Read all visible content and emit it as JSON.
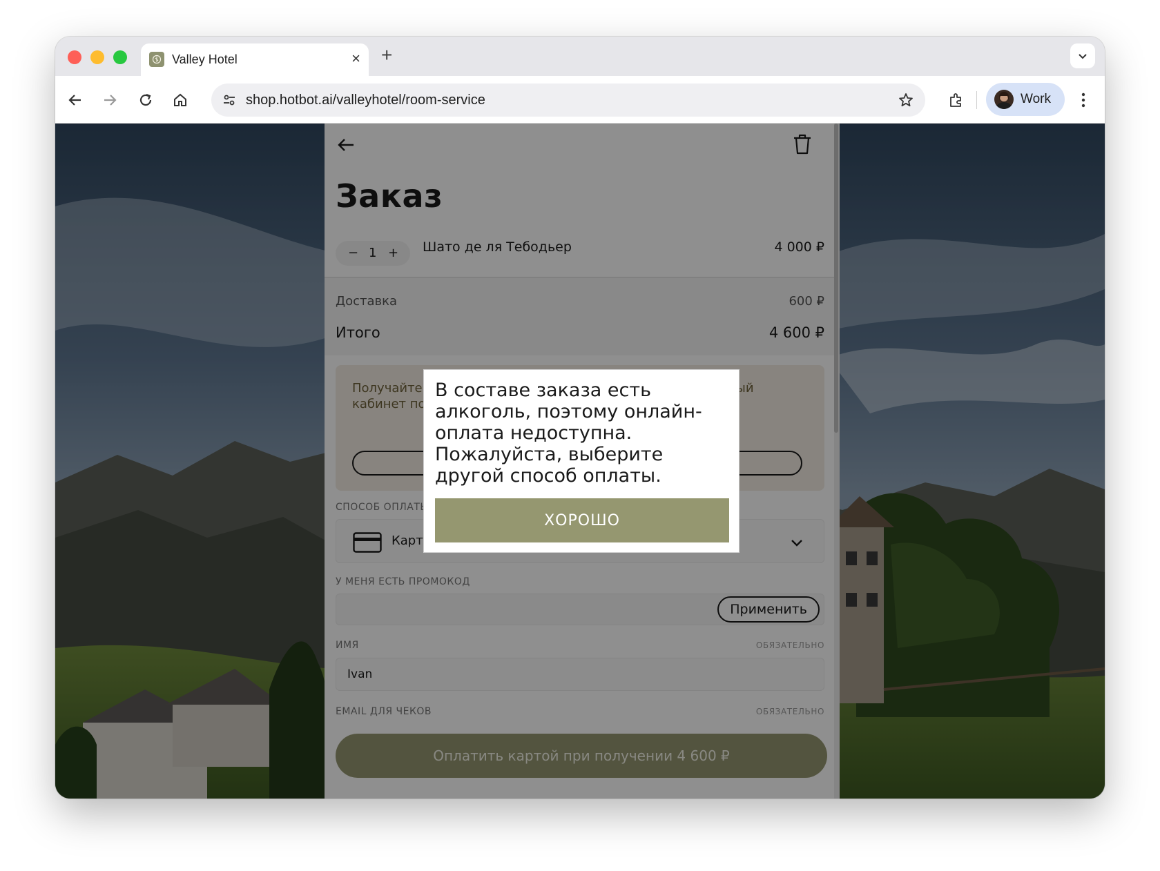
{
  "browser": {
    "tab_title": "Valley Hotel",
    "url": "shop.hotbot.ai/valleyhotel/room-service",
    "profile_name": "Work"
  },
  "order": {
    "title": "Заказ",
    "items": [
      {
        "quantity": "1",
        "name": "Шато де ля Тебодьер",
        "price": "4 000 ₽"
      }
    ],
    "delivery_label": "Доставка",
    "delivery_price": "600 ₽",
    "total_label": "Итого",
    "total_price": "4 600 ₽",
    "loyalty_text": "Получайте бонусы и скидки в Valley Hotel. Войдите в личный кабинет пользователя, чтобы отслеживать",
    "loyalty_brand": "Valley Hotel",
    "payment_method_label": "Способ оплаты",
    "payment_method_value": "Картой при получении",
    "promo_label": "У меня есть промокод",
    "promo_apply": "Применить",
    "name_label": "Имя",
    "name_required": "Обязательно",
    "name_value": "Ivan",
    "email_label": "Email для чеков",
    "email_required": "Обязательно",
    "pay_button": "Оплатить картой при получении 4 600 ₽"
  },
  "dialog": {
    "message": "В составе заказа есть алкоголь, поэтому онлайн-оплата недоступна. Пожалуйста, выберите другой способ оплаты.",
    "ok": "ХОРОШО"
  },
  "colors": {
    "accent": "#959770",
    "loyalty_bg": "#f2ece2"
  }
}
